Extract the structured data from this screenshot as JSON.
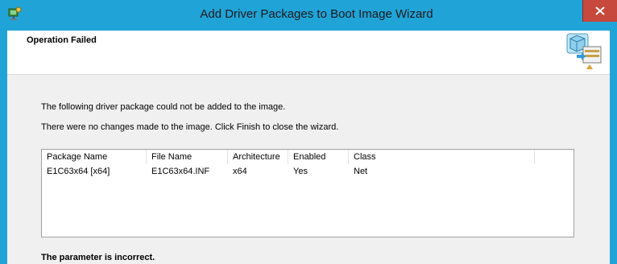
{
  "window": {
    "title": "Add Driver Packages to Boot Image Wizard",
    "app_icon": "driver-wizard-icon",
    "close_icon": "close-icon"
  },
  "header": {
    "title": "Operation Failed",
    "icon": "driver-package-wizard-icon"
  },
  "content": {
    "message_1": "The following driver package could not be added to the image.",
    "message_2": "There were no changes made to the image. Click Finish to close the wizard.",
    "table": {
      "columns": [
        "Package Name",
        "File Name",
        "Architecture",
        "Enabled",
        "Class"
      ],
      "rows": [
        [
          "E1C63x64 [x64]",
          "E1C63x64.INF",
          "x64",
          "Yes",
          "Net"
        ]
      ]
    },
    "error": "The parameter is incorrect."
  },
  "colors": {
    "frame": "#20a4d8",
    "close": "#c7483d"
  }
}
